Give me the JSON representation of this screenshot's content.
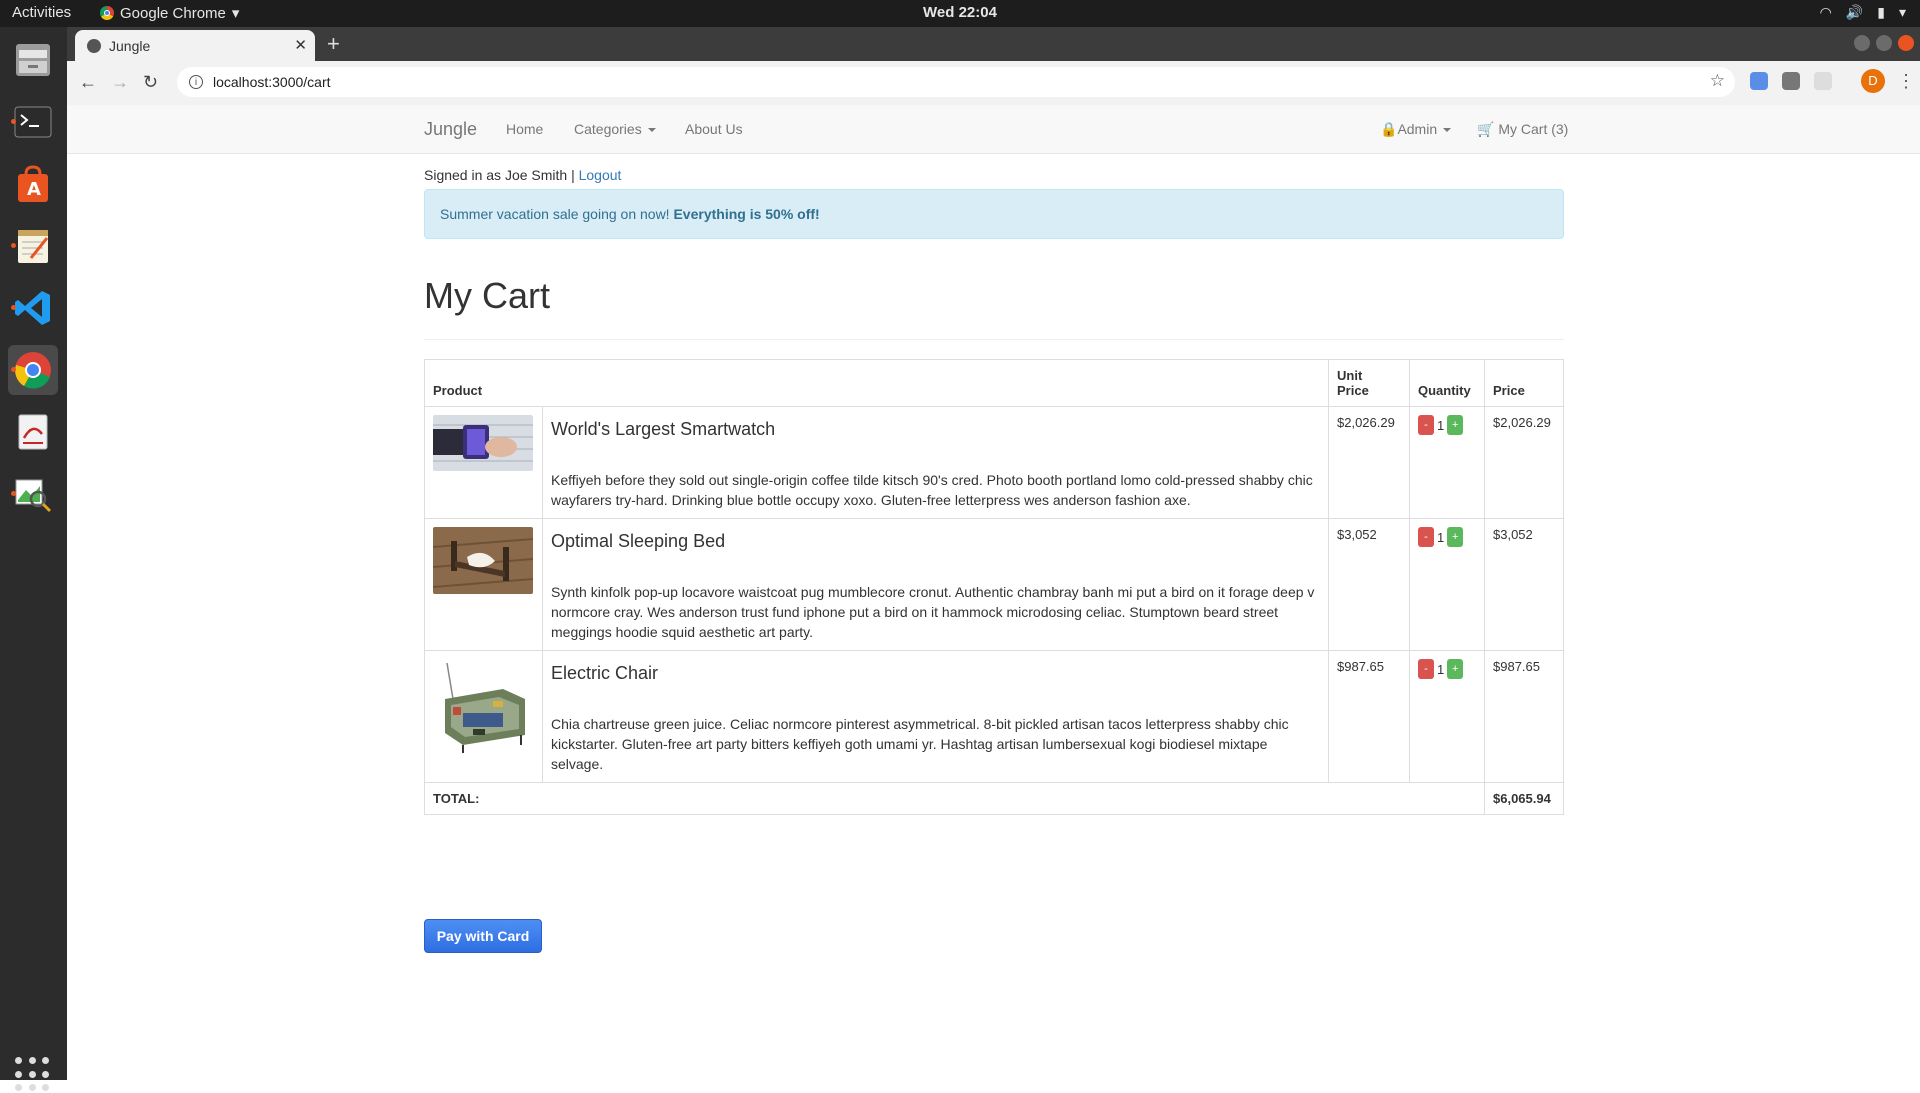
{
  "system": {
    "activities": "Activities",
    "app_name": "Google Chrome",
    "clock": "Wed 22:04"
  },
  "browser": {
    "tab_title": "Jungle",
    "url": "localhost:3000/cart",
    "profile_initial": "D"
  },
  "navbar": {
    "brand": "Jungle",
    "home": "Home",
    "categories": "Categories",
    "about": "About Us",
    "admin": "Admin",
    "cart": "My Cart (3)"
  },
  "session": {
    "signed_in_text": "Signed in as Joe Smith |",
    "logout": "Logout"
  },
  "alert": {
    "text": "Summer vacation sale going on now!",
    "bold": "Everything is 50% off!"
  },
  "page_title": "My Cart",
  "table": {
    "headers": {
      "product": "Product",
      "unit_price_1": "Unit",
      "unit_price_2": "Price",
      "quantity": "Quantity",
      "price": "Price"
    },
    "rows": [
      {
        "name": "World's Largest Smartwatch",
        "description": "Keffiyeh before they sold out single-origin coffee tilde kitsch 90's cred. Photo booth portland lomo cold-pressed shabby chic wayfarers try-hard. Drinking blue bottle occupy xoxo. Gluten-free letterpress wes anderson fashion axe.",
        "unit_price": "$2,026.29",
        "quantity": "1",
        "price": "$2,026.29"
      },
      {
        "name": "Optimal Sleeping Bed",
        "description": "Synth kinfolk pop-up locavore waistcoat pug mumblecore cronut. Authentic chambray banh mi put a bird on it forage deep v normcore cray. Wes anderson trust fund iphone put a bird on it hammock microdosing celiac. Stumptown beard street meggings hoodie squid aesthetic art party.",
        "unit_price": "$3,052",
        "quantity": "1",
        "price": "$3,052"
      },
      {
        "name": "Electric Chair",
        "description": "Chia chartreuse green juice. Celiac normcore pinterest asymmetrical. 8-bit pickled artisan tacos letterpress shabby chic kickstarter. Gluten-free art party bitters keffiyeh goth umami yr. Hashtag artisan lumbersexual kogi biodiesel mixtape selvage.",
        "unit_price": "$987.65",
        "quantity": "1",
        "price": "$987.65"
      }
    ],
    "total_label": "TOTAL:",
    "total_value": "$6,065.94",
    "minus": "-",
    "plus": "+"
  },
  "pay_button": "Pay with Card"
}
